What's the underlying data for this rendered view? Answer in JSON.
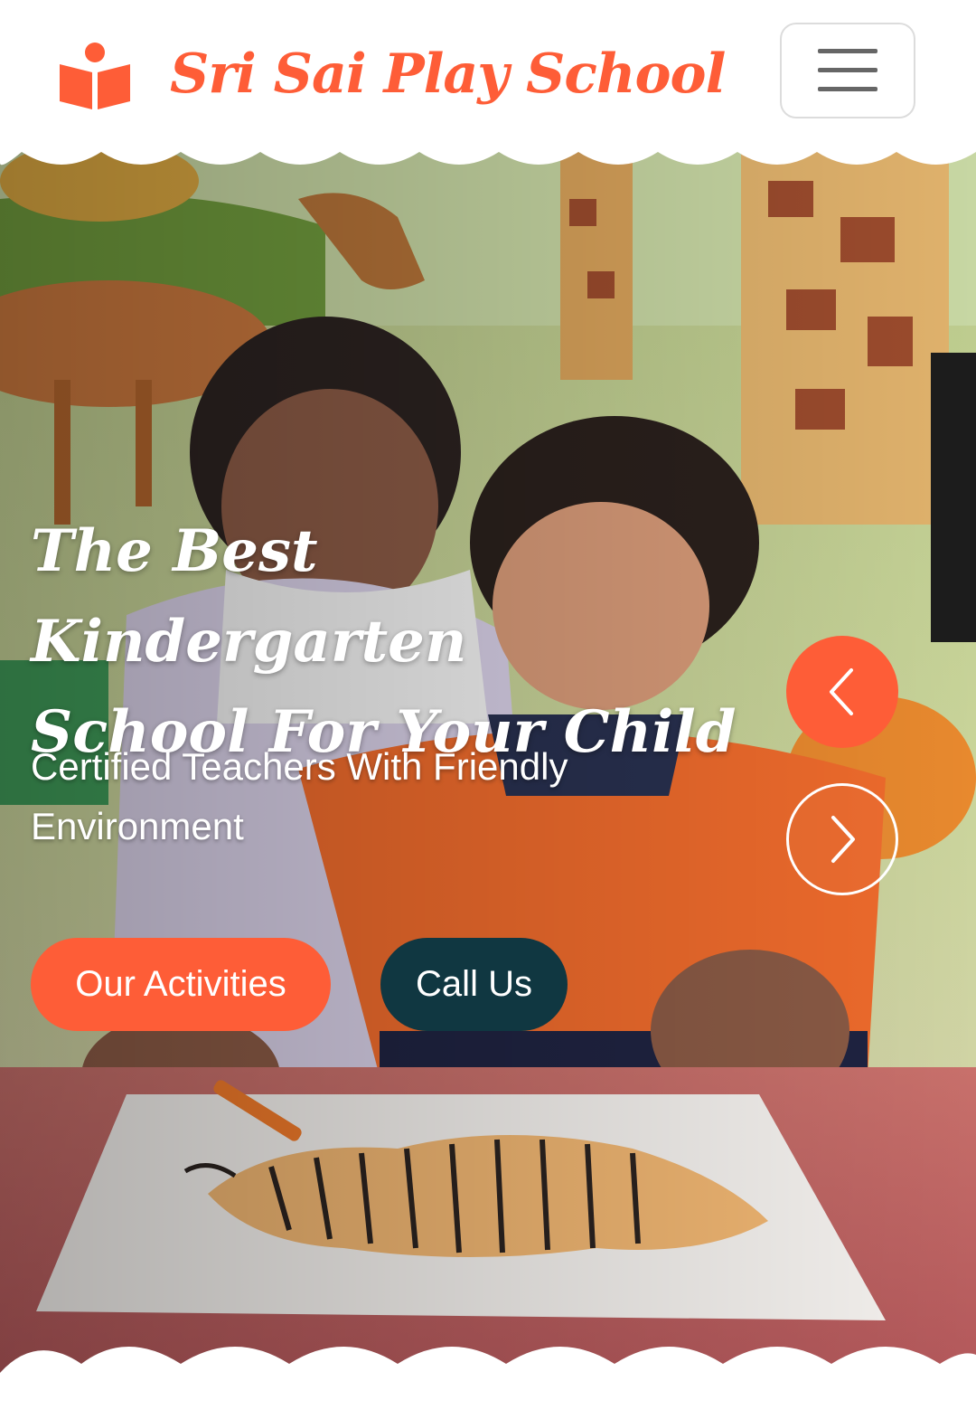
{
  "header": {
    "brand_name": "Sri Sai Play School",
    "brand_icon": "book-reader-icon",
    "menu_icon": "hamburger-menu-icon"
  },
  "hero": {
    "title_line1": "The Best Kindergarten",
    "title_line2": "School For Your Child",
    "subtitle": "Certified Teachers With Friendly Environment",
    "primary_button": "Our Activities",
    "secondary_button": "Call Us",
    "prev_icon": "chevron-left-icon",
    "next_icon": "chevron-right-icon"
  },
  "colors": {
    "accent": "#FE5D37",
    "dark": "#103741",
    "white": "#FFFFFF"
  }
}
